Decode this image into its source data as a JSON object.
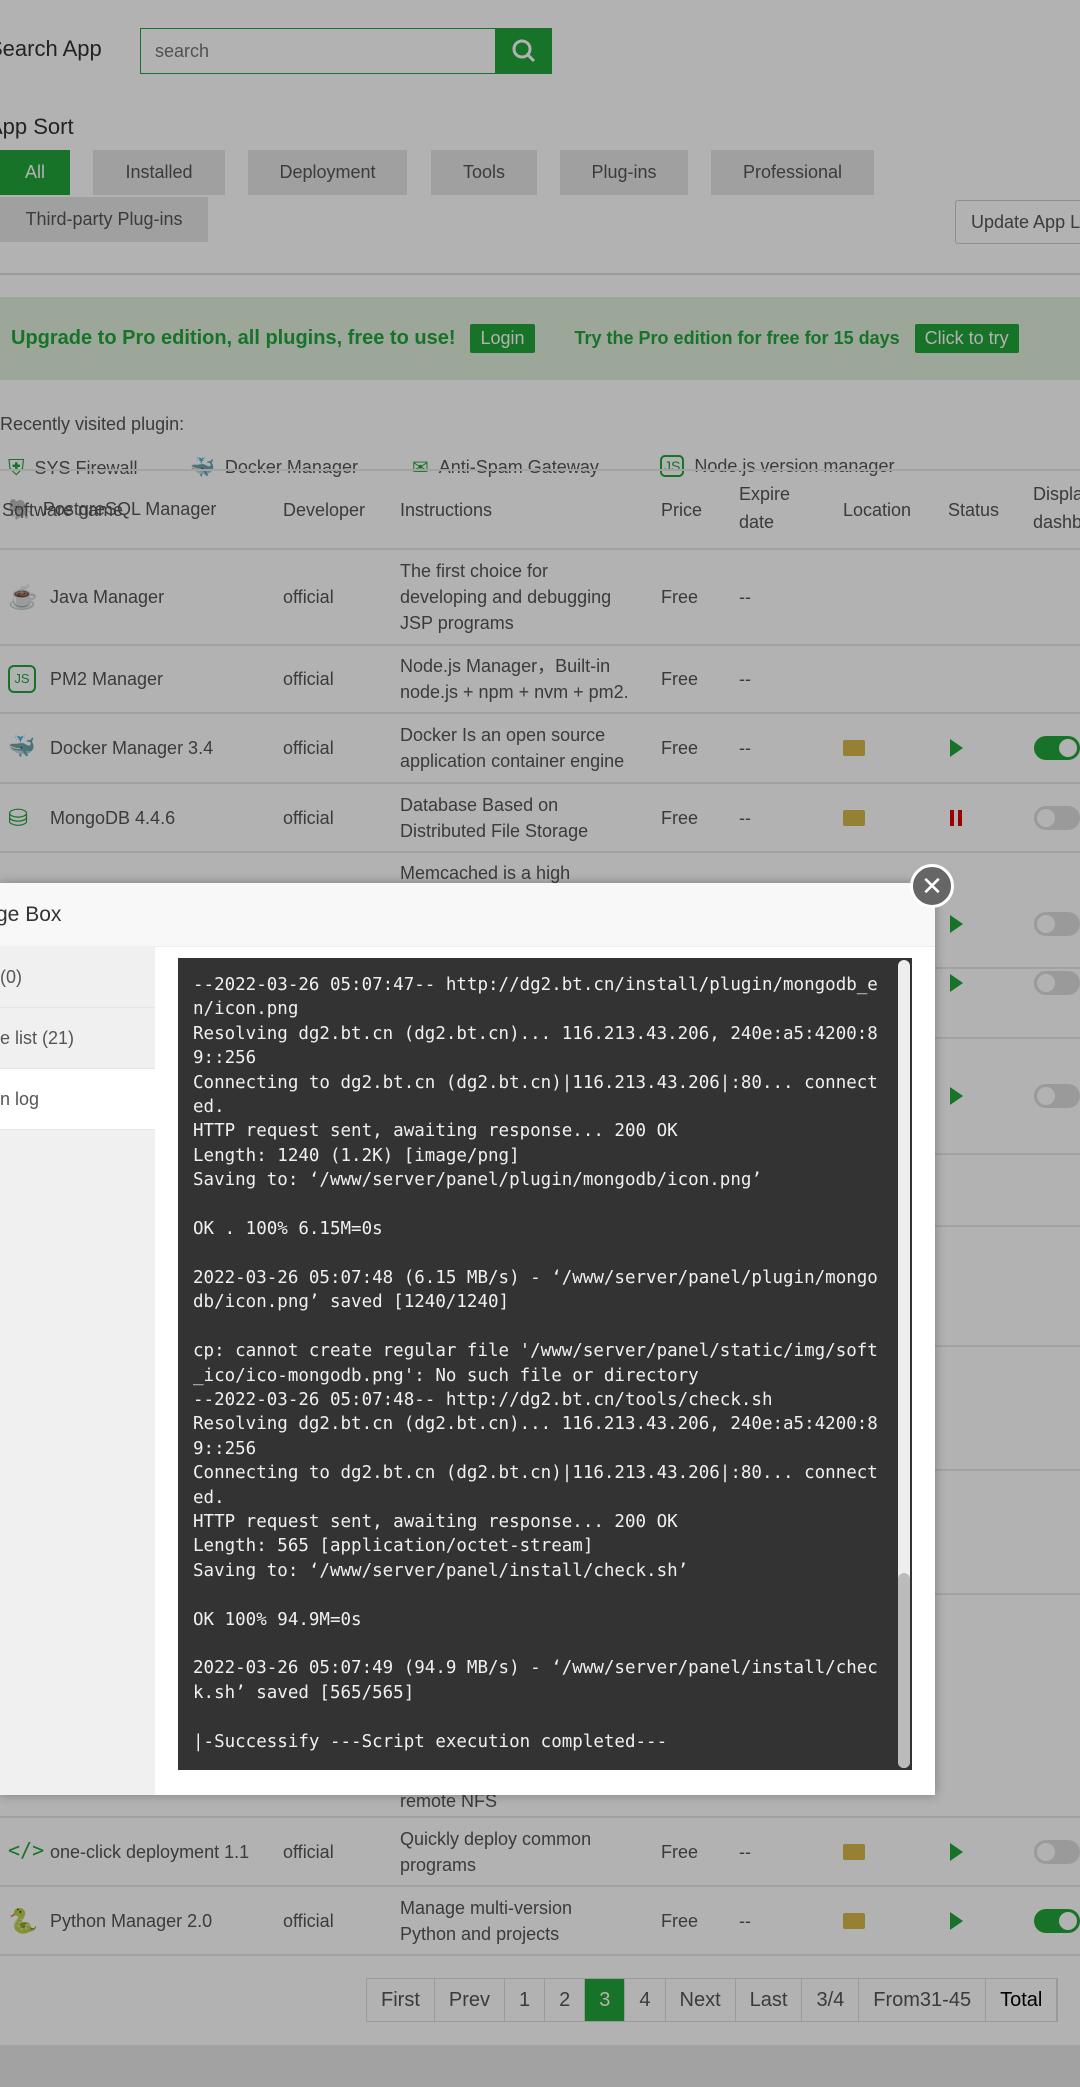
{
  "search": {
    "label": "Search App",
    "placeholder": "search"
  },
  "sort": {
    "label": "App Sort",
    "categories": [
      "All",
      "Installed",
      "Deployment",
      "Tools",
      "Plug-ins",
      "Professional",
      "Third-party Plug-ins"
    ],
    "update_label": "Update App L"
  },
  "banner": {
    "text1": "Upgrade to Pro edition, all plugins, free to use!",
    "login": "Login",
    "text2": "Try the Pro edition for free for 15 days",
    "try": "Click to try"
  },
  "recent": {
    "label": "Recently visited plugin:",
    "items": [
      "SYS Firewall",
      "Docker Manager",
      "Anti-Spam Gateway",
      "Node.js version manager",
      "PostgreSQL Manager"
    ]
  },
  "table": {
    "headers": [
      "Software name",
      "Developer",
      "Instructions",
      "Price",
      "Expire date",
      "Location",
      "Status",
      "Display dashb"
    ],
    "rows": [
      {
        "name": "Java Manager",
        "dev": "official",
        "desc": "The first choice for developing and debugging JSP programs",
        "price": "Free",
        "expire": "--"
      },
      {
        "name": "PM2 Manager",
        "dev": "official",
        "desc": "Node.js Manager，Built-in node.js + npm + nvm + pm2.",
        "price": "Free",
        "expire": "--"
      },
      {
        "name": "Docker Manager 3.4",
        "dev": "official",
        "desc": "Docker Is an open source application container engine",
        "price": "Free",
        "expire": "--",
        "status": "running",
        "display": true
      },
      {
        "name": "MongoDB 4.4.6",
        "dev": "official",
        "desc": "Database Based on Distributed File Storage",
        "price": "Free",
        "expire": "--",
        "status": "stopped",
        "display": false
      },
      {
        "desc": "Memcached is a high"
      },
      {
        "desc": "remote NFS"
      },
      {
        "name": "one-click deployment 1.1",
        "dev": "official",
        "desc": "Quickly deploy common programs",
        "price": "Free",
        "expire": "--",
        "status": "running",
        "display": false
      },
      {
        "name": "Python Manager 2.0",
        "dev": "official",
        "desc": "Manage multi-version Python and projects",
        "price": "Free",
        "expire": "--",
        "status": "running",
        "display": true
      }
    ]
  },
  "pagination": {
    "items": [
      "First",
      "Prev",
      "1",
      "2",
      "3",
      "4",
      "Next",
      "Last",
      "3/4",
      "From31-45",
      "Total"
    ],
    "current": "3"
  },
  "modal": {
    "title": "ge Box",
    "tabs": [
      "(0)",
      "e list (21)",
      "n log"
    ],
    "log": "--2022-03-26 05:07:47-- http://dg2.bt.cn/install/plugin/mongodb_e\nn/icon.png\nResolving dg2.bt.cn (dg2.bt.cn)... 116.213.43.206, 240e:a5:4200:8\n9::256\nConnecting to dg2.bt.cn (dg2.bt.cn)|116.213.43.206|:80... connect\ned.\nHTTP request sent, awaiting response... 200 OK\nLength: 1240 (1.2K) [image/png]\nSaving to: ‘/www/server/panel/plugin/mongodb/icon.png’\n\nOK . 100% 6.15M=0s\n\n2022-03-26 05:07:48 (6.15 MB/s) - ‘/www/server/panel/plugin/mongo\ndb/icon.png’ saved [1240/1240]\n\ncp: cannot create regular file '/www/server/panel/static/img/soft\n_ico/ico-mongodb.png': No such file or directory\n--2022-03-26 05:07:48-- http://dg2.bt.cn/tools/check.sh\nResolving dg2.bt.cn (dg2.bt.cn)... 116.213.43.206, 240e:a5:4200:8\n9::256\nConnecting to dg2.bt.cn (dg2.bt.cn)|116.213.43.206|:80... connect\ned.\nHTTP request sent, awaiting response... 200 OK\nLength: 565 [application/octet-stream]\nSaving to: ‘/www/server/panel/install/check.sh’\n\nOK 100% 94.9M=0s\n\n2022-03-26 05:07:49 (94.9 MB/s) - ‘/www/server/panel/install/chec\nk.sh’ saved [565/565]\n\n|-Successify ---Script execution completed---"
  },
  "colors": {
    "accent": "#20a53a",
    "terminal": "#333333"
  }
}
